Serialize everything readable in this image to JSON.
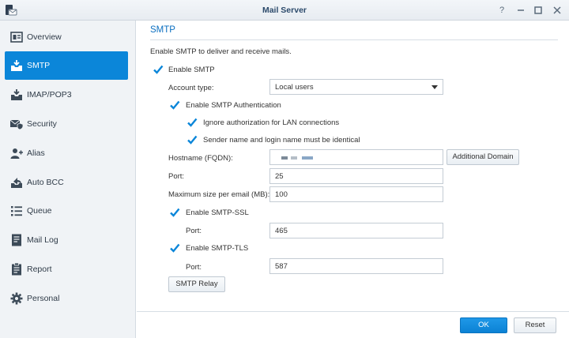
{
  "window": {
    "title": "Mail Server"
  },
  "sidebar": {
    "items": [
      {
        "label": "Overview"
      },
      {
        "label": "SMTP"
      },
      {
        "label": "IMAP/POP3"
      },
      {
        "label": "Security"
      },
      {
        "label": "Alias"
      },
      {
        "label": "Auto BCC"
      },
      {
        "label": "Queue"
      },
      {
        "label": "Mail Log"
      },
      {
        "label": "Report"
      },
      {
        "label": "Personal"
      }
    ]
  },
  "main": {
    "section_title": "SMTP",
    "description": "Enable SMTP to deliver and receive mails.",
    "enable_smtp": {
      "label": "Enable SMTP",
      "checked": true
    },
    "account_type": {
      "label": "Account type:",
      "value": "Local users"
    },
    "enable_auth": {
      "label": "Enable SMTP Authentication",
      "checked": true
    },
    "ignore_lan": {
      "label": "Ignore authorization for LAN connections",
      "checked": true
    },
    "sender_identical": {
      "label": "Sender name and login name must be identical",
      "checked": true
    },
    "hostname": {
      "label": "Hostname (FQDN):",
      "value": ""
    },
    "additional_domain_label": "Additional Domain",
    "port": {
      "label": "Port:",
      "value": "25"
    },
    "max_size": {
      "label": "Maximum size per email (MB):",
      "value": "100"
    },
    "ssl": {
      "label": "Enable SMTP-SSL",
      "checked": true,
      "port_label": "Port:",
      "port_value": "465"
    },
    "tls": {
      "label": "Enable SMTP-TLS",
      "checked": true,
      "port_label": "Port:",
      "port_value": "587"
    },
    "relay_label": "SMTP Relay"
  },
  "footer": {
    "ok_label": "OK",
    "reset_label": "Reset"
  },
  "colors": {
    "accent": "#0b86d9",
    "title": "#0b6fc1",
    "check": "#0b86d9"
  }
}
